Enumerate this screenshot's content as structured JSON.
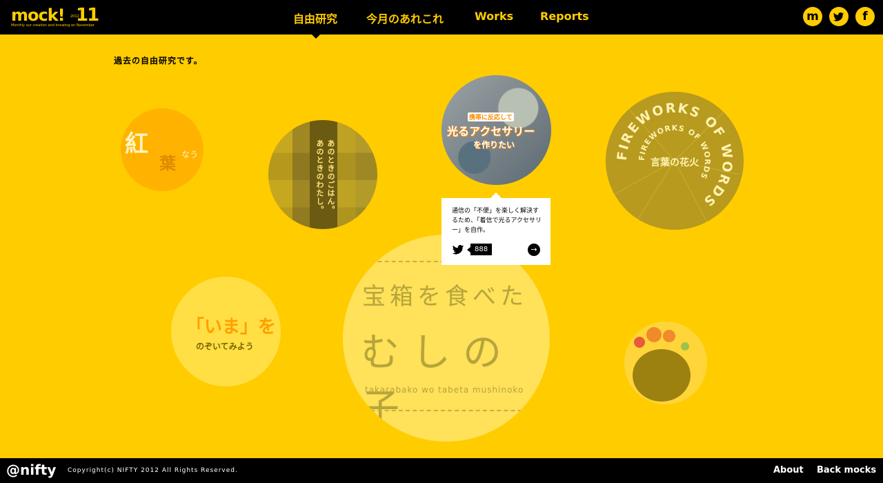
{
  "header": {
    "logo_brand": "mock!",
    "logo_number": "11",
    "logo_year": "2012",
    "logo_tagline": "Monthly our creation and knowing on November",
    "nav": [
      "自由研究",
      "今月のあれこれ",
      "Works",
      "Reports"
    ],
    "social": [
      "m",
      "twitter",
      "f"
    ]
  },
  "intro": "過去の自由研究です。",
  "circles": {
    "koyo": {
      "k1": "紅",
      "k2": "葉",
      "k3": "なう"
    },
    "gohan": {
      "line1": "あのときのごはん。",
      "line2": "あのときのわたし。"
    },
    "led": {
      "t1": "携帯に反応して",
      "t2": "光るアクセサリー",
      "t3": "を作りたい"
    },
    "fireworks": {
      "ring": "FIREWORKS OF WORDS",
      "center": "言葉の花火"
    },
    "ima": {
      "l1": "「いま」を",
      "l2": "のぞいてみよう"
    },
    "mushi": {
      "m1": "宝箱を食べた",
      "m2": "むしの子",
      "m3": "takarabako wo tabeta mushinoko"
    }
  },
  "tooltip": {
    "description": "通信の「不便」を楽しく解決するため、「着信で光るアクセサリー」を自作。",
    "count": "888",
    "arrow": "→"
  },
  "footer": {
    "brand": "@nifty",
    "copyright": "Copyright(c) NIFTY 2012 All Rights Reserved.",
    "links": [
      "About",
      "Back mocks"
    ]
  },
  "colors": {
    "accent": "#ffcc00",
    "header": "#000000"
  }
}
